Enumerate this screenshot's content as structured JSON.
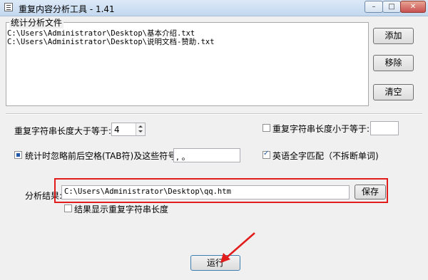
{
  "window": {
    "title": "重复内容分析工具 - 1.41",
    "controls": {
      "minimize": "–",
      "maximize": "□",
      "close": "✕"
    }
  },
  "files_group": {
    "legend": "统计分析文件",
    "files": [
      "C:\\Users\\Administrator\\Desktop\\基本介绍.txt",
      "C:\\Users\\Administrator\\Desktop\\说明文档-赞助.txt"
    ],
    "buttons": {
      "add": "添加",
      "remove": "移除",
      "clear": "清空"
    }
  },
  "options": {
    "min_length_label": "重复字符串长度大于等于:",
    "min_length_value": "4",
    "max_length_label": "重复字符串长度小于等于:",
    "max_length_value": "",
    "ignore_label": "统计时忽略前后空格(TAB符)及这些符号:",
    "ignore_value": ", 。",
    "english_label": "英语全字匹配（不拆断单词)"
  },
  "result": {
    "label": "分析结果:",
    "path": "C:\\Users\\Administrator\\Desktop\\qq.htm",
    "save_button": "保存",
    "show_length_label": "结果显示重复字符串长度"
  },
  "run_button": "运行",
  "colors": {
    "highlight": "#e21b1b",
    "checkbox": "#1e5aa8"
  }
}
